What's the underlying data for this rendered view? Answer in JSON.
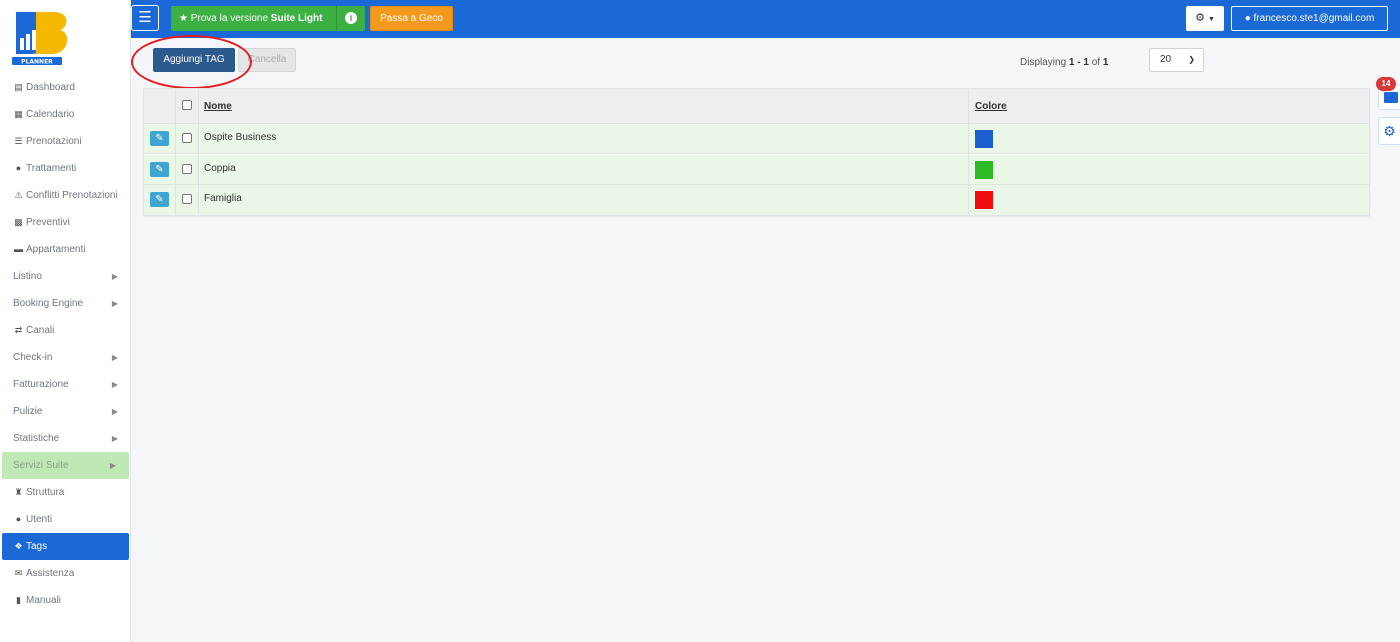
{
  "brand": {
    "logo_text": "PLANNER"
  },
  "sidebar": {
    "items": [
      {
        "label": "Dashboard",
        "icon": "monitor-icon"
      },
      {
        "label": "Calendario",
        "icon": "calendar-icon"
      },
      {
        "label": "Prenotazioni",
        "icon": "list-icon"
      },
      {
        "label": "Trattamenti",
        "icon": "apple-icon"
      },
      {
        "label": "Conflitti Prenotazioni",
        "icon": "warning-icon"
      },
      {
        "label": "Preventivi",
        "icon": "calculator-icon"
      },
      {
        "label": "Appartamenti",
        "icon": "bed-icon"
      },
      {
        "label": "Listino",
        "icon": "",
        "submenu": true
      },
      {
        "label": "Booking Engine",
        "icon": "",
        "submenu": true
      },
      {
        "label": "Canali",
        "icon": "shuffle-icon"
      },
      {
        "label": "Check-in",
        "icon": "",
        "submenu": true
      },
      {
        "label": "Fatturazione",
        "icon": "",
        "submenu": true
      },
      {
        "label": "Pulizie",
        "icon": "",
        "submenu": true
      },
      {
        "label": "Statistiche",
        "icon": "",
        "submenu": true
      },
      {
        "label": "Servizi Suite",
        "icon": "",
        "submenu": true,
        "highlight": true
      },
      {
        "label": "Struttura",
        "icon": "castle-icon"
      },
      {
        "label": "Utenti",
        "icon": "user-icon"
      },
      {
        "label": "Tags",
        "icon": "tags-icon",
        "active": true
      },
      {
        "label": "Assistenza",
        "icon": "envelope-icon"
      },
      {
        "label": "Manuali",
        "icon": "book-icon"
      }
    ]
  },
  "topbar": {
    "try_prefix": "Prova la versione ",
    "try_bold": "Suite Light",
    "switch_label": "Passa a Geco",
    "user_email": "francesco.ste1@gmail.com"
  },
  "toolbar": {
    "add_label": "Aggiungi TAG",
    "cancel_label": "Cancella",
    "displaying_prefix": "Displaying ",
    "range": "1 - 1",
    "of_text": " of ",
    "total": "1",
    "page_size": "20"
  },
  "table": {
    "col_name": "Nome",
    "col_color": "Colore",
    "rows": [
      {
        "name": "Ospite Business",
        "color": "#1a5fd0"
      },
      {
        "name": "Coppia",
        "color": "#2dbb27"
      },
      {
        "name": "Famiglia",
        "color": "#f00c0c"
      }
    ]
  },
  "notifications": {
    "count": "14"
  },
  "colors": {
    "primary": "#1b69d6",
    "green": "#3cb043",
    "orange": "#f39a1e",
    "row_bg": "#eaf6e6",
    "active": "#1b69d6"
  }
}
